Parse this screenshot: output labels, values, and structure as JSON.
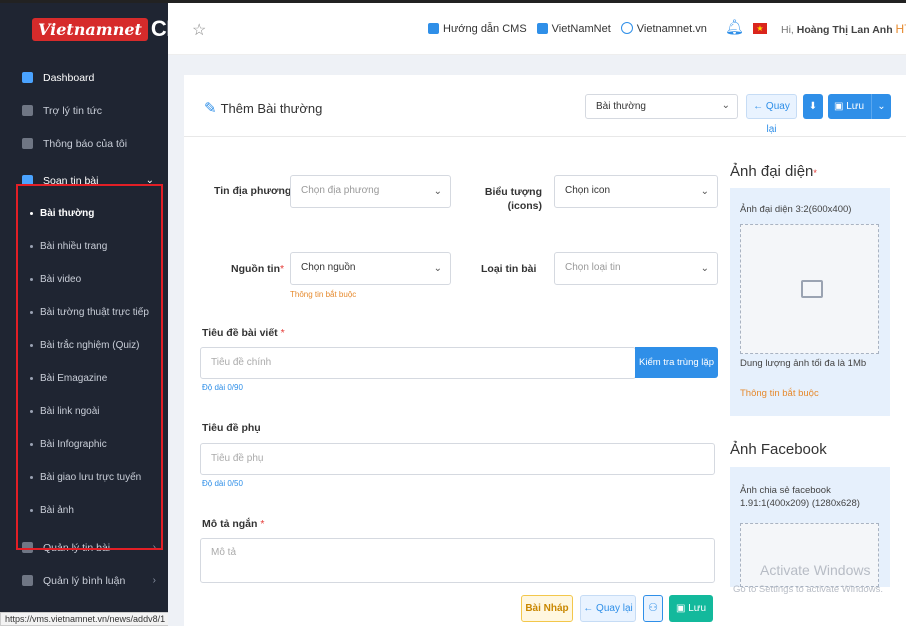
{
  "brand": {
    "logo_mark": "Vietnamnet",
    "logo_text": "CMS",
    "collapse": "«"
  },
  "sidebar": {
    "items": [
      {
        "label": "Dashboard",
        "icon": "home-icon"
      },
      {
        "label": "Trợ lý tin tức",
        "icon": "document-icon"
      },
      {
        "label": "Thông báo của tôi",
        "icon": "document-icon"
      }
    ],
    "group": {
      "label": "Soạn tin bài",
      "icon": "edit-icon",
      "children": [
        {
          "label": "Bài thường",
          "active": true
        },
        {
          "label": "Bài nhiều trang"
        },
        {
          "label": "Bài video"
        },
        {
          "label": "Bài tường thuật trực tiếp"
        },
        {
          "label": "Bài trắc nghiệm (Quiz)"
        },
        {
          "label": "Bài Emagazine"
        },
        {
          "label": "Bài link ngoài"
        },
        {
          "label": "Bài Infographic"
        },
        {
          "label": "Bài giao lưu trực tuyến"
        },
        {
          "label": "Bài ảnh"
        }
      ]
    },
    "after": [
      {
        "label": "Quản lý tin bài",
        "icon": "document-icon"
      },
      {
        "label": "Quản lý bình luận",
        "icon": "comment-icon"
      }
    ]
  },
  "status_url": "https://vms.vietnamnet.vn/news/addv8/1",
  "header": {
    "links": [
      "Hướng dẫn CMS",
      "VietNamNet",
      "Vietnamnet.vn"
    ],
    "greeting_prefix": "Hi,",
    "user_name": "Hoàng Thị Lan Anh",
    "user_tag": "HTLA"
  },
  "page": {
    "title": "Thêm Bài thường",
    "type_select": "Bài thường",
    "back": "← Quay lại",
    "save": "Lưu"
  },
  "form": {
    "local_news": {
      "label": "Tin địa phương",
      "placeholder": "Chọn địa phương"
    },
    "icons": {
      "label_1": "Biểu tượng",
      "label_2": "(icons)",
      "value": "Chọn icon"
    },
    "source": {
      "label": "Nguồn tin",
      "value": "Chọn nguồn",
      "hint": "Thông tin bắt buộc"
    },
    "category": {
      "label": "Loại tin bài",
      "placeholder": "Chọn loại tin"
    },
    "title": {
      "label": "Tiêu đề bài viết",
      "placeholder": "Tiêu đề chính",
      "count": "Độ dài 0/90",
      "check": "Kiểm tra trùng lặp"
    },
    "subtitle": {
      "label": "Tiêu đề phụ",
      "placeholder": "Tiêu đề phụ",
      "count": "Độ dài 0/50"
    },
    "summary": {
      "label": "Mô tả ngắn",
      "placeholder": "Mô tả"
    }
  },
  "avatar_panel": {
    "title": "Ảnh đại diện",
    "caption": "Ảnh đại diện 3:2(600x400)",
    "note": "Dung lượng ảnh tối đa là 1Mb",
    "required": "Thông tin bắt buộc"
  },
  "facebook_panel": {
    "title": "Ảnh Facebook",
    "caption_1": "Ảnh chia sẻ facebook",
    "caption_2": "1.91:1(400x209) (1280x628)"
  },
  "watermark": {
    "line1": "Activate Windows",
    "line2": "Go to Settings to activate Windows."
  },
  "bottom_bar": {
    "draft": "Bài Nháp",
    "back": "← Quay lại",
    "save": "Lưu"
  },
  "colors": {
    "sidebar_bg": "#1f2532",
    "accent": "#2f8fe8",
    "highlight_border": "#e21f26",
    "save_green": "#13b99c",
    "draft_yellow": "#f3c74b"
  }
}
